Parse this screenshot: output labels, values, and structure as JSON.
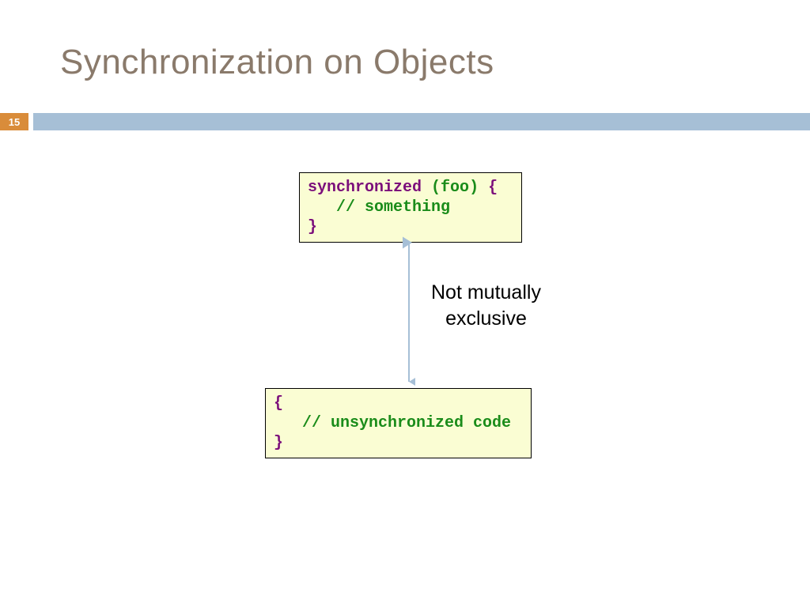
{
  "title": "Synchronization on Objects",
  "page_number": "15",
  "code_top": {
    "keyword": "synchronized",
    "open_paren": " (",
    "variable": "foo",
    "close_paren": ")",
    "open_brace": " {",
    "comment": "   // something",
    "close_brace": "}"
  },
  "code_bottom": {
    "open_brace": "{",
    "comment": "   // unsynchronized code",
    "close_brace": "}"
  },
  "annotation_line1": "Not mutually",
  "annotation_line2": "exclusive",
  "colors": {
    "title": "#8a7a6b",
    "badge": "#d98c3a",
    "bar": "#a6bfd6",
    "code_bg": "#fafdd3",
    "keyword": "#7b0f7b",
    "code_green": "#1a8c1a",
    "arrow": "#a6bfd6"
  }
}
